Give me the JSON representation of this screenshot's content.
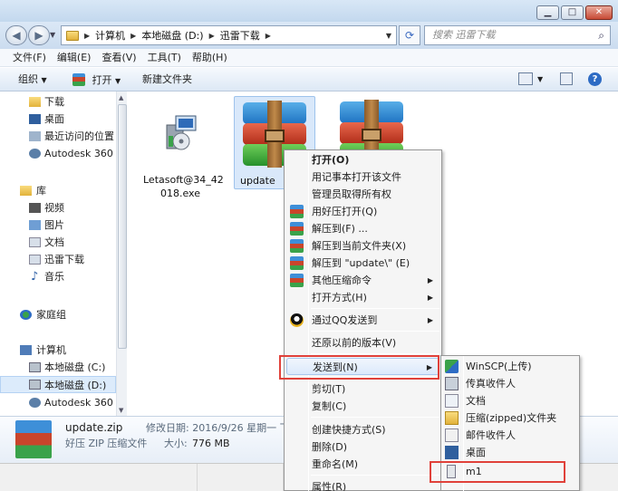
{
  "window": {
    "address": [
      "计算机",
      "本地磁盘 (D:)",
      "迅雷下载"
    ],
    "search_placeholder": "搜索 迅雷下载"
  },
  "menubar": [
    "文件(F)",
    "编辑(E)",
    "查看(V)",
    "工具(T)",
    "帮助(H)"
  ],
  "toolbar": {
    "organize": "组织",
    "open": "打开",
    "new_folder": "新建文件夹"
  },
  "nav": {
    "favorites": [
      "下载",
      "桌面",
      "最近访问的位置",
      "Autodesk 360"
    ],
    "library": "库",
    "library_items": [
      "视频",
      "图片",
      "文档",
      "迅雷下载",
      "音乐"
    ],
    "homegroup": "家庭组",
    "computer": "计算机",
    "computer_items": [
      "本地磁盘 (C:)",
      "本地磁盘 (D:)",
      "Autodesk 360"
    ]
  },
  "files": [
    {
      "name_line1": "Letasoft@34_42",
      "name_line2": "018.exe",
      "icon": "setup-icon"
    },
    {
      "name": "update",
      "icon": "winrar-archive-icon",
      "selected": true
    },
    {
      "name": "",
      "icon": "winrar-archive-icon"
    }
  ],
  "details": {
    "filename": "update.zip",
    "type": "好压 ZIP 压缩文件",
    "modified_label": "修改日期: 2016/9/26 星期一 下...",
    "size_label": "大小:",
    "size_value": "776 MB"
  },
  "context_menu": [
    {
      "label": "打开(O)",
      "bold": true
    },
    {
      "label": "用记事本打开该文件"
    },
    {
      "label": "管理员取得所有权"
    },
    {
      "label": "用好压打开(Q)",
      "icon": "haozip-icon"
    },
    {
      "label": "解压到(F) ...",
      "icon": "haozip-icon"
    },
    {
      "label": "解压到当前文件夹(X)",
      "icon": "haozip-icon"
    },
    {
      "label": "解压到 \"update\\\" (E)",
      "icon": "haozip-icon"
    },
    {
      "label": "其他压缩命令",
      "icon": "haozip-icon",
      "submenu": true
    },
    {
      "label": "打开方式(H)",
      "submenu": true
    },
    {
      "label": "通过QQ发送到",
      "icon": "qq-icon",
      "submenu": true
    },
    {
      "label": "还原以前的版本(V)"
    },
    {
      "label": "发送到(N)",
      "submenu": true,
      "highlighted": true
    },
    {
      "label": "剪切(T)"
    },
    {
      "label": "复制(C)"
    },
    {
      "label": "创建快捷方式(S)"
    },
    {
      "label": "删除(D)"
    },
    {
      "label": "重命名(M)"
    },
    {
      "label": "属性(R)"
    }
  ],
  "send_to_menu": [
    {
      "label": "WinSCP(上传)",
      "icon": "winscp-icon"
    },
    {
      "label": "传真收件人",
      "icon": "fax-icon"
    },
    {
      "label": "文档",
      "icon": "documents-icon"
    },
    {
      "label": "压缩(zipped)文件夹",
      "icon": "zip-folder-icon"
    },
    {
      "label": "邮件收件人",
      "icon": "mail-icon"
    },
    {
      "label": "桌面",
      "icon": "desktop-icon"
    },
    {
      "label": "m1",
      "icon": "usb-drive-icon"
    }
  ],
  "colors": {
    "highlight_box": "#e0413a",
    "selection": "#d9e8fa"
  }
}
